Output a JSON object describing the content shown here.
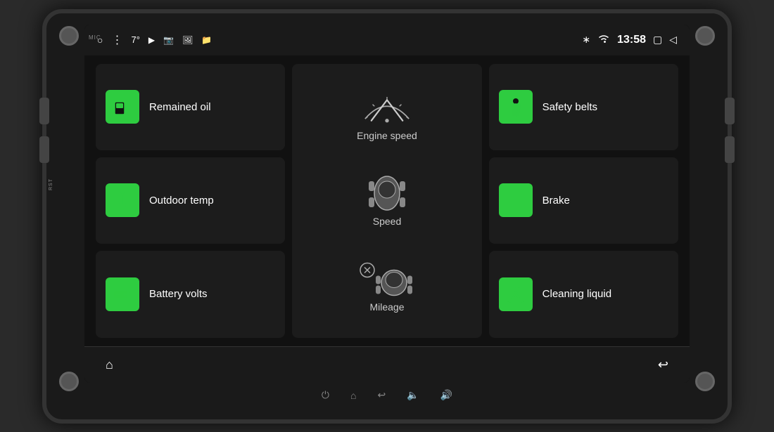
{
  "device": {
    "mic_label": "MIC",
    "rst_label": "RST"
  },
  "status_bar": {
    "temperature": "7°",
    "time": "13:58",
    "icons": [
      "circle",
      "dots",
      "youtube",
      "camera1",
      "camera2",
      "camera3",
      "bluetooth",
      "wifi",
      "square",
      "back-arrow"
    ]
  },
  "tiles": {
    "remained_oil": {
      "label": "Remained oil",
      "icon": "fuel"
    },
    "outdoor_temp": {
      "label": "Outdoor temp",
      "icon": "thermometer"
    },
    "battery_volts": {
      "label": "Battery volts",
      "icon": "battery"
    },
    "safety_belts": {
      "label": "Safety belts",
      "icon": "seatbelt"
    },
    "brake": {
      "label": "Brake",
      "icon": "brake"
    },
    "cleaning_liquid": {
      "label": "Cleaning liquid",
      "icon": "wiper"
    }
  },
  "center_tile": {
    "engine_speed_label": "Engine speed",
    "speed_label": "Speed",
    "mileage_label": "Mileage"
  },
  "bottom_nav": {
    "home_icon": "⌂",
    "back_icon": "↩"
  },
  "physical_bottom": {
    "power_icon": "⏻",
    "home_icon": "⌂",
    "back_icon": "↩",
    "vol_down": "🔈",
    "vol_up": "🔊"
  },
  "colors": {
    "green": "#2ecc40",
    "dark_bg": "#111",
    "tile_bg": "#1c1c1c",
    "text": "#ffffff",
    "status_bg": "#1a1a1a"
  }
}
